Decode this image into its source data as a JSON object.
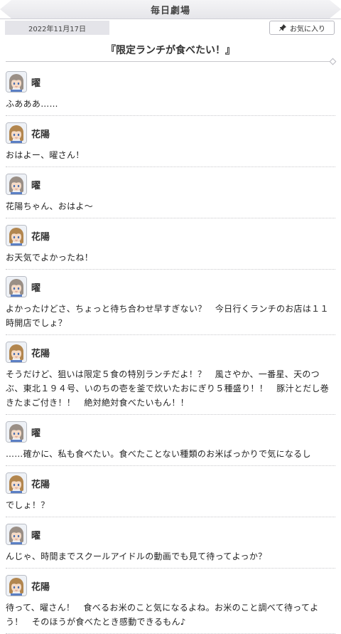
{
  "header": {
    "title": "毎日劇場"
  },
  "meta": {
    "date": "2022年11月17日",
    "favorite_label": "お気に入り"
  },
  "story": {
    "title": "『限定ランチが食べたい！』"
  },
  "dialogue": [
    {
      "speaker": "曜",
      "avatar": "you-avatar",
      "text": "ふあああ……"
    },
    {
      "speaker": "花陽",
      "avatar": "hanayo-avatar",
      "text": "おはよー、曜さん！"
    },
    {
      "speaker": "曜",
      "avatar": "you-avatar",
      "text": "花陽ちゃん、おはよ〜"
    },
    {
      "speaker": "花陽",
      "avatar": "hanayo-avatar",
      "text": "お天気でよかったね！"
    },
    {
      "speaker": "曜",
      "avatar": "you-avatar",
      "text": "よかったけどさ、ちょっと待ち合わせ早すぎない？　今日行くランチのお店は１１時開店でしょ？"
    },
    {
      "speaker": "花陽",
      "avatar": "hanayo-avatar",
      "text": "そうだけど、狙いは限定５食の特別ランチだよ！？　風さやか、一番星、天のつぶ、東北１９４号、いのちの壱を釜で炊いたおにぎり５種盛り！！　豚汁とだし巻きたまご付き！！　絶対絶対食べたいもん！！"
    },
    {
      "speaker": "曜",
      "avatar": "you-avatar",
      "text": "……確かに、私も食べたい。食べたことない種類のお米ばっかりで気になるし"
    },
    {
      "speaker": "花陽",
      "avatar": "hanayo-avatar",
      "text": "でしょ！？"
    },
    {
      "speaker": "曜",
      "avatar": "you-avatar",
      "text": "んじゃ、時間までスクールアイドルの動画でも見て待ってよっか？"
    },
    {
      "speaker": "花陽",
      "avatar": "hanayo-avatar",
      "text": "待って、曜さん！　食べるお米のこと気になるよね。お米のこと調べて待ってよう！　そのほうが食べたとき感動できるもん♪"
    }
  ],
  "colors": {
    "you_hair": "#9a8f86",
    "hanayo_hair": "#b2864f",
    "skin": "#f6dcc8",
    "avatar_bg": "#eef1f6"
  }
}
